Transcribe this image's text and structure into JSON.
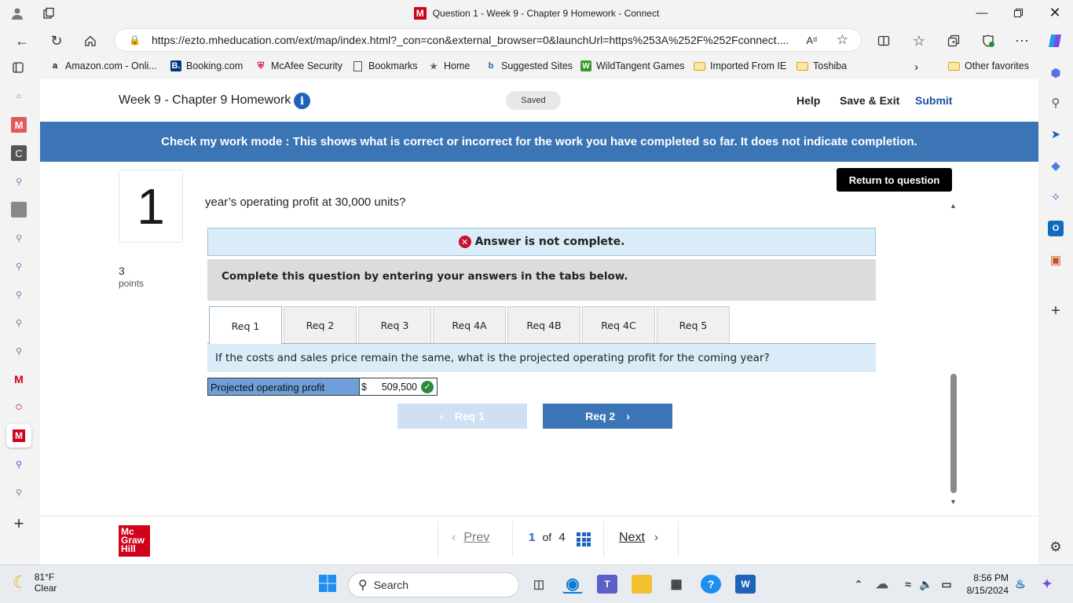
{
  "window": {
    "title": "Question 1 - Week 9 - Chapter 9 Homework - Connect",
    "logo_letter": "M"
  },
  "browser": {
    "url": "https://ezto.mheducation.com/ext/map/index.html?_con=con&external_browser=0&launchUrl=https%253A%252F%252Fconnect....",
    "read_aloud": "A̅ʼ"
  },
  "favorites": [
    {
      "label": "Amazon.com - Onli...",
      "icon": "amazon-icon"
    },
    {
      "label": "Booking.com",
      "icon": "booking-icon"
    },
    {
      "label": "McAfee Security",
      "icon": "mcafee-icon"
    },
    {
      "label": "Bookmarks",
      "icon": "page-icon"
    },
    {
      "label": "Home",
      "icon": "home-icon"
    },
    {
      "label": "Suggested Sites",
      "icon": "bing-icon"
    },
    {
      "label": "WildTangent Games",
      "icon": "wildtangent-icon"
    },
    {
      "label": "Imported From IE",
      "icon": "folder-icon"
    },
    {
      "label": "Toshiba",
      "icon": "folder-icon"
    }
  ],
  "other_favorites": "Other favorites",
  "header": {
    "title": "Week 9 - Chapter 9 Homework",
    "saved": "Saved",
    "help": "Help",
    "save_exit": "Save & Exit",
    "submit": "Submit"
  },
  "banner": "Check my work mode : This shows what is correct or incorrect for the work you have completed so far. It does not indicate completion.",
  "question": {
    "number": "1",
    "points": "3",
    "points_label": "points",
    "text": "year’s operating profit at 30,000 units?",
    "return_button": "Return to question",
    "status": "Answer is not complete.",
    "instruction": "Complete this question by entering your answers in the tabs below.",
    "tabs": [
      "Req 1",
      "Req 2",
      "Req 3",
      "Req 4A",
      "Req 4B",
      "Req 4C",
      "Req 5"
    ],
    "active_tab": 0,
    "req_question": "If the costs and sales price remain the same, what is the projected operating profit for the coming year?",
    "answer_label": "Projected operating profit",
    "answer_currency": "$",
    "answer_value": "509,500",
    "prev_req": "Req 1",
    "next_req": "Req 2"
  },
  "footer": {
    "prev": "Prev",
    "current": "1",
    "of": "of",
    "total": "4",
    "next": "Next",
    "logo": [
      "Mc",
      "Graw",
      "Hill"
    ]
  },
  "taskbar": {
    "temp": "81°F",
    "weather": "Clear",
    "search": "Search",
    "time": "8:56 PM",
    "date": "8/15/2024"
  },
  "colors": {
    "banner": "#3b75b6",
    "primary_button": "#3b75b6",
    "answer_label_bg": "#6f9fd8",
    "error": "#c8102e",
    "success": "#2e8b3b"
  }
}
